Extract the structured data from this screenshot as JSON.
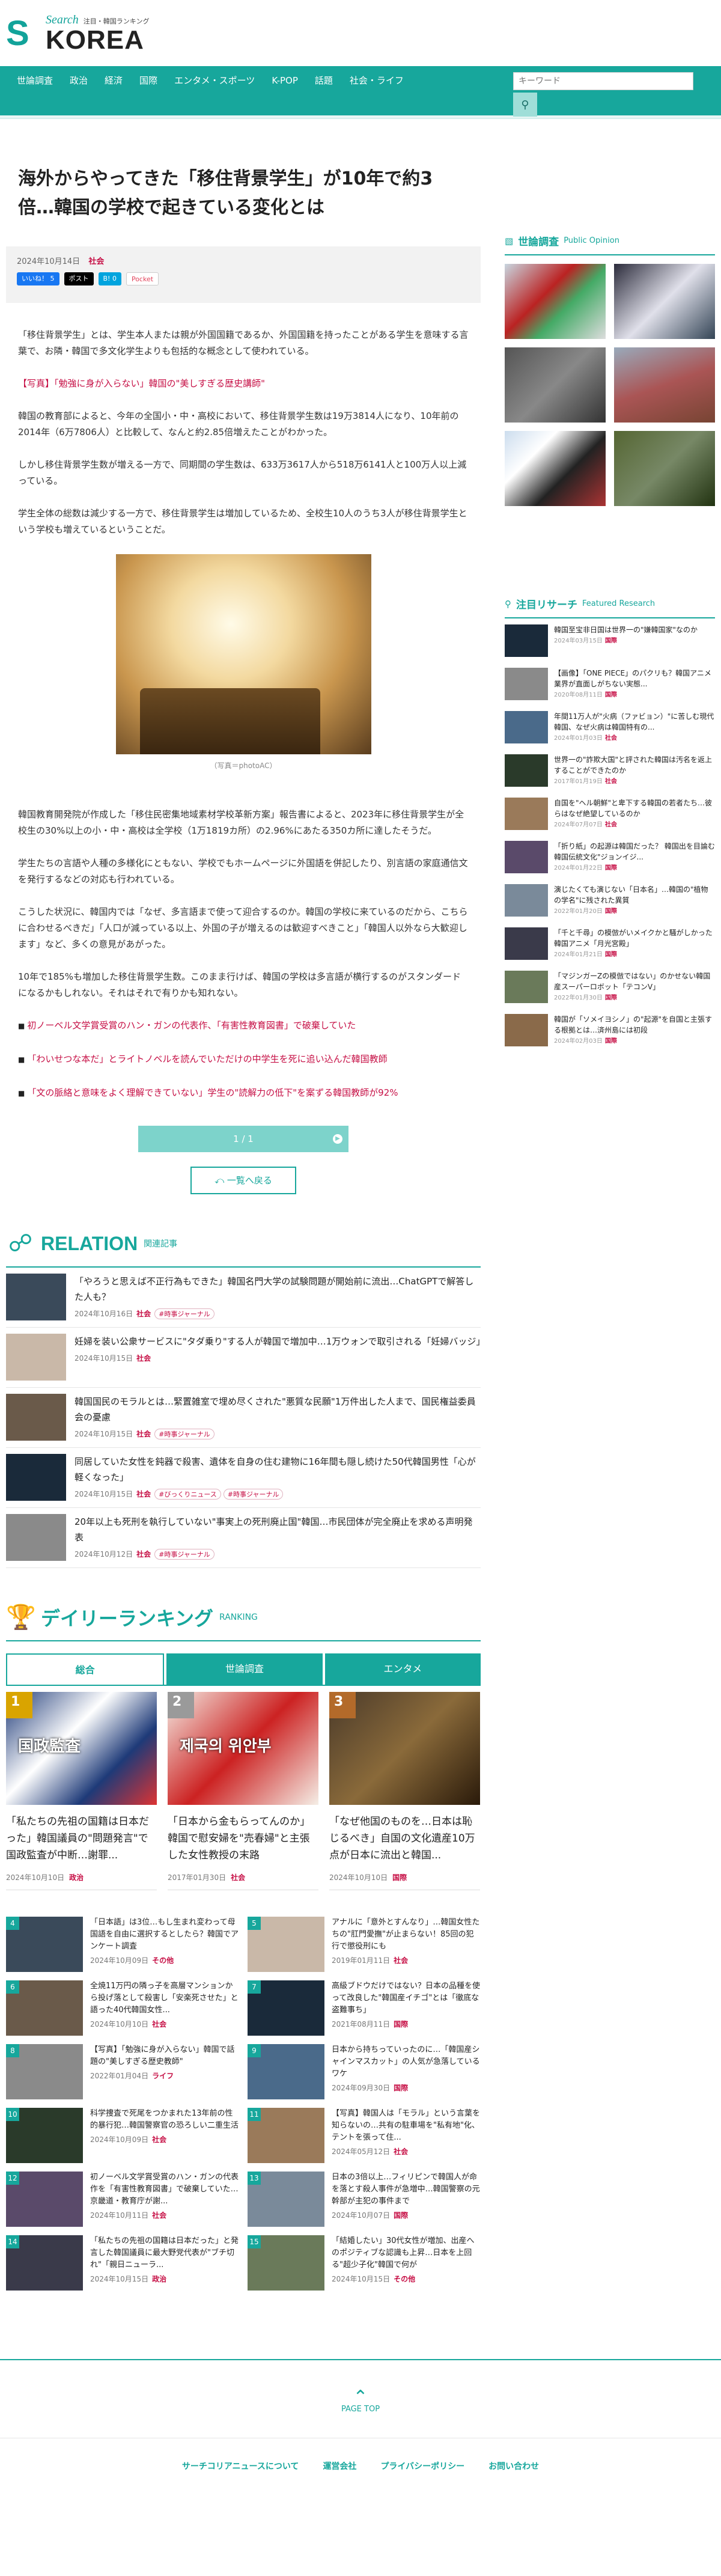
{
  "brand": {
    "search": "Search",
    "tagline": "注目・韓国ランキング",
    "korea": "KOREA",
    "s_letter": "S"
  },
  "nav": {
    "items": [
      "世論調査",
      "政治",
      "経済",
      "国際",
      "エンタメ・スポーツ",
      "K-POP",
      "話題",
      "社会・ライフ"
    ],
    "search_placeholder": "キーワード",
    "search_icon": "search-icon"
  },
  "article": {
    "title": "海外からやってきた「移住背景学生」が10年で約3倍…韓国の学校で起きている変化とは",
    "date": "2024年10月14日",
    "category": "社会",
    "share": {
      "facebook": "いいね！ 5",
      "x": "ポスト",
      "hatena": "B! 0",
      "pocket": "Pocket"
    },
    "paragraphs": [
      "「移住背景学生」とは、学生本人または親が外国国籍であるか、外国国籍を持ったことがある学生を意味する言葉で、お隣・韓国で多文化学生よりも包括的な概念として使われている。",
      "韓国の教育部によると、今年の全国小・中・高校において、移住背景学生数は19万3814人になり、10年前の2014年（6万7806人）と比較して、なんと約2.85倍増えたことがわかった。",
      "しかし移住背景学生数が増える一方で、同期間の学生数は、633万3617人から518万6141人と100万人以上減っている。",
      "学生全体の総数は減少する一方で、移住背景学生は増加しているため、全校生10人のうち3人が移住背景学生という学校も増えているということだ。"
    ],
    "photo_link": "【写真】「勉強に身が入らない」韓国の\"美しすぎる歴史講師\"",
    "caption": "（写真＝photoAC）",
    "paragraphs2": [
      "韓国教育開発院が作成した「移住民密集地域素材学校革新方案」報告書によると、2023年に移住背景学生が全校生の30%以上の小・中・高校は全学校（1万1819カ所）の2.96%にあたる350カ所に達したそうだ。",
      "学生たちの言語や人種の多様化にともない、学校でもホームページに外国語を併記したり、別言語の家庭通信文を発行するなどの対応も行われている。",
      "こうした状況に、韓国内では「なぜ、多言語まで使って迎合するのか。韓国の学校に来ているのだから、こちらに合わせるべきだ」「人口が減っている以上、外国の子が増えるのは歓迎すべきこと」「韓国人以外なら大歓迎します」など、多くの意見があがった。",
      "10年で185%も増加した移住背景学生数。このまま行けば、韓国の学校は多言語が横行するのがスタンダードになるかもしれない。それはそれで有りかも知れない。"
    ],
    "related_links": [
      "初ノーベル文学賞受賞のハン・ガンの代表作、「有害性教育図書」で破棄していた",
      "「わいせつな本だ」とライトノベルを読んでいただけの中学生を死に追い込んだ韓国教師",
      "「文の脈絡と意味をよく理解できていない」学生の\"読解力の低下\"を案ずる韓国教師が92%"
    ],
    "pager": "1 / 1",
    "back": "一覧へ戻る"
  },
  "relation": {
    "title": "RELATION",
    "sub": "関連記事",
    "items": [
      {
        "title": "「やろうと思えば不正行為もできた」韓国名門大学の試験問題が開始前に流出…ChatGPTで解答した人も？",
        "date": "2024年10月16日",
        "category": "社会",
        "tags": [
          "#時事ジャーナル"
        ]
      },
      {
        "title": "妊婦を装い公衆サービスに\"タダ乗り\"する人が韓国で増加中…1万ウォンで取引される「妊婦バッジ」",
        "date": "2024年10月15日",
        "category": "社会",
        "tags": []
      },
      {
        "title": "韓国国民のモラルとは…緊置雑室で埋め尽くされた\"悪質な民願\"1万件出した人まで、国民権益委員会の憂慮",
        "date": "2024年10月15日",
        "category": "社会",
        "tags": [
          "#時事ジャーナル"
        ]
      },
      {
        "title": "同居していた女性を鈍器で殺害、遺体を自身の住む建物に16年間も隠し続けた50代韓国男性「心が軽くなった」",
        "date": "2024年10月15日",
        "category": "社会",
        "tags": [
          "#びっくりニュース",
          "#時事ジャーナル"
        ]
      },
      {
        "title": "20年以上も死刑を執行していない\"事実上の死刑廃止国\"韓国…市民団体が完全廃止を求める声明発表",
        "date": "2024年10月12日",
        "category": "社会",
        "tags": [
          "#時事ジャーナル"
        ]
      }
    ]
  },
  "ranking": {
    "title": "デイリーランキング",
    "sub": "RANKING",
    "tabs": [
      "総合",
      "世論調査",
      "エンタメ"
    ],
    "top3": [
      {
        "rank": "1",
        "title": "「私たちの先祖の国籍は日本だった」韓国議員の\"問題発言\"で国政監査が中断…謝罪...",
        "date": "2024年10月10日",
        "category": "政治",
        "img_text": "国政監査"
      },
      {
        "rank": "2",
        "title": "「日本から金もらってんのか」韓国で慰安婦を\"売春婦\"と主張した女性教授の末路",
        "date": "2017年01月30日",
        "category": "社会",
        "img_text": "제국의 위안부"
      },
      {
        "rank": "3",
        "title": "「なぜ他国のものを…日本は恥じるべき」自国の文化遺産10万点が日本に流出と韓国...",
        "date": "2024年10月10日",
        "category": "国際",
        "img_text": ""
      }
    ],
    "list": [
      {
        "rank": "4",
        "title": "「日本語」は3位…もし生まれ変わって母国語を自由に選択するとしたら？韓国でアンケート調査",
        "date": "2024年10月09日",
        "category": "その他"
      },
      {
        "rank": "5",
        "title": "アナルに「意外とすんなり」…韓国女性たちの\"肛門愛撫\"が止まらない！85回の犯行で懲役刑にも",
        "date": "2019年01月11日",
        "category": "社会"
      },
      {
        "rank": "6",
        "title": "全焼11万円の隣っ子を高層マンションから投げ落として殺害し「安楽死させた」と語った40代韓国女性...",
        "date": "2024年10月10日",
        "category": "社会"
      },
      {
        "rank": "7",
        "title": "高級ブドウだけではない？日本の品種を使って改良した\"韓国産イチゴ\"とは「徹底な盗難事ち」",
        "date": "2021年08月11日",
        "category": "国際"
      },
      {
        "rank": "8",
        "title": "【写真】「勉強に身が入らない」韓国で話題の\"美しすぎる歴史教師\"",
        "date": "2022年01月04日",
        "category": "ライフ"
      },
      {
        "rank": "9",
        "title": "日本から持ちっていったのに…「韓国産シャインマスカット」の人気が急落しているワケ",
        "date": "2024年09月30日",
        "category": "国際"
      },
      {
        "rank": "10",
        "title": "科学捜査で死尾をつかまれた13年前の性的暴行犯…韓国警察官の恐ろしい二重生活",
        "date": "2024年10月09日",
        "category": "社会"
      },
      {
        "rank": "11",
        "title": "【写真】韓国人は「モラル」という言葉を知らないの…共有の駐車場を\"私有地\"化、テントを張って住...",
        "date": "2024年05月12日",
        "category": "社会"
      },
      {
        "rank": "12",
        "title": "初ノーベル文学賞受賞のハン・ガンの代表作を「有害性教育図書」で破棄していた…京畿道・教育庁が謝...",
        "date": "2024年10月11日",
        "category": "社会"
      },
      {
        "rank": "13",
        "title": "日本の3倍以上…フィリピンで韓国人が命を落とす殺人事件が急増中…韓国警察の元幹部が主犯の事件まで",
        "date": "2024年10月07日",
        "category": "国際"
      },
      {
        "rank": "14",
        "title": "「私たちの先祖の国籍は日本だった」と発言した韓国議員に最大野党代表が\"ブチ切れ\"「親日ニューラ...",
        "date": "2024年10月15日",
        "category": "政治"
      },
      {
        "rank": "15",
        "title": "「結婚したい」30代女性が増加、出産へのポジティブな認識も上昇…日本を上回る\"超少子化\"韓国で何が",
        "date": "2024年10月15日",
        "category": "その他"
      }
    ]
  },
  "sidebar": {
    "poll_title": "世論調査",
    "poll_en": "Public Opinion",
    "research_title": "注目リサーチ",
    "research_en": "Featured Research",
    "research": [
      {
        "title": "韓国至宝非日国は世界一の\"嫌韓国家\"なのか",
        "date": "2024年03月15日",
        "category": "国際"
      },
      {
        "title": "【画像】「ONE PIECE」のパクリも？韓国アニメ業界が直面しがちない実態...",
        "date": "2020年08月11日",
        "category": "国際"
      },
      {
        "title": "年間11万人が\"火病（ファビョン）\"に苦しむ現代韓国、なぜ火病は韓国特有の...",
        "date": "2024年01月03日",
        "category": "社会"
      },
      {
        "title": "世界一の\"詐欺大国\"と評された韓国は汚名を返上することができたのか",
        "date": "2017年01月19日",
        "category": "社会"
      },
      {
        "title": "自国を\"ヘル朝鮮\"と卑下する韓国の若者たち…彼らはなぜ絶望しているのか",
        "date": "2024年07月07日",
        "category": "社会"
      },
      {
        "title": "「折り紙」の起源は韓国だった？ 韓国出を目論む韓国伝統文化\"ジョンイジ...",
        "date": "2024年01月22日",
        "category": "国際"
      },
      {
        "title": "演じたくても演じない「日本名」…韓国の\"植物の学名\"に残された異質",
        "date": "2022年01月20日",
        "category": "国際"
      },
      {
        "title": "「千と千尋」の模倣がいメイクかと騒がしかった韓国アニメ「月光宮殿」",
        "date": "2024年01月21日",
        "category": "国際"
      },
      {
        "title": "「マジンガーZの模倣ではない」のかせない韓国産スーパーロボット「テコンV」",
        "date": "2022年01月30日",
        "category": "国際"
      },
      {
        "title": "韓国が「ソメイヨシノ」の\"起源\"を自国と主張する根拠とは…済州島には初段",
        "date": "2024年02月03日",
        "category": "国際"
      }
    ]
  },
  "footer": {
    "pagetop": "PAGE TOP",
    "links": [
      "サーチコリアニュースについて",
      "運営会社",
      "プライバシーポリシー",
      "お問い合わせ"
    ]
  },
  "colors": {
    "primary": "#17a79c",
    "accent": "#c60f45"
  }
}
